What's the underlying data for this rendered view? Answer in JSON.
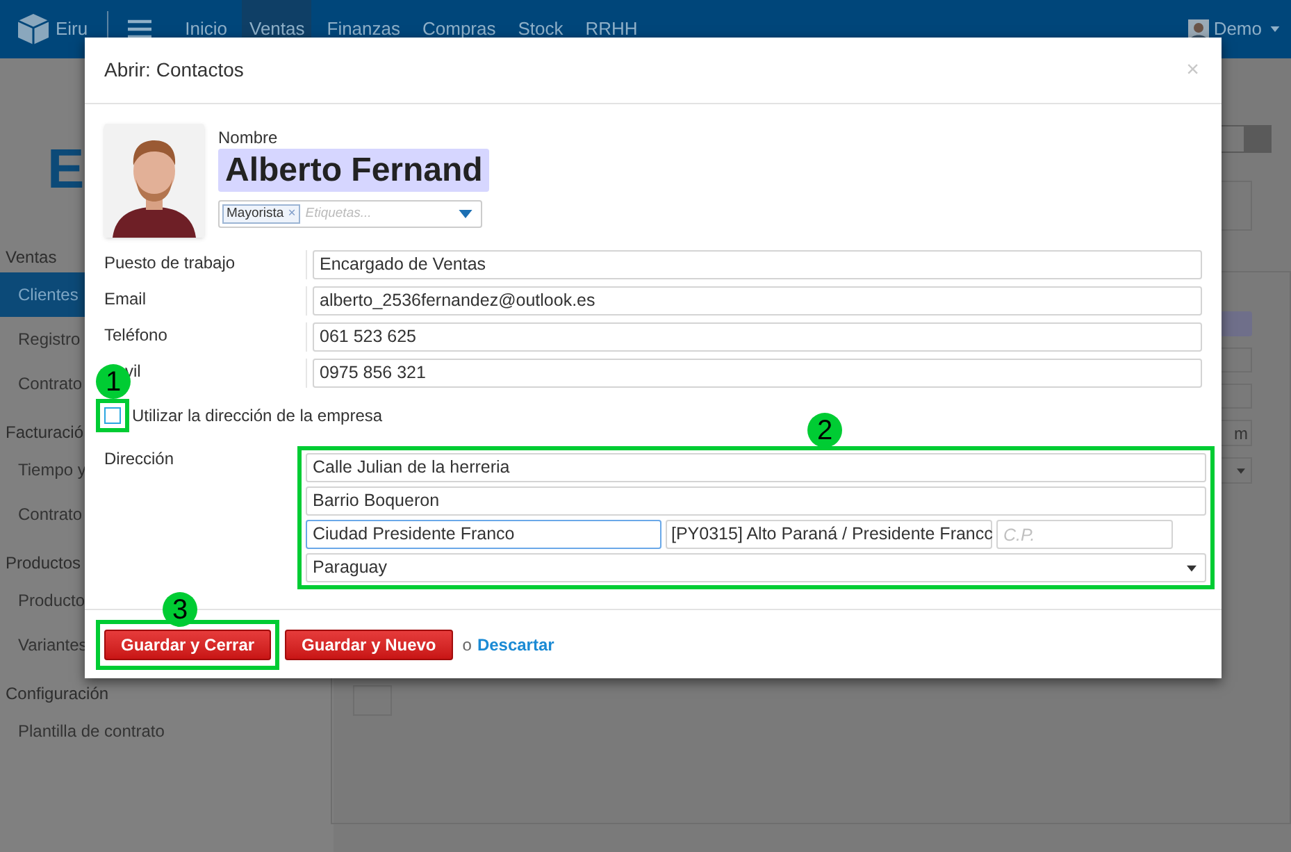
{
  "navbar": {
    "brand": "Eiru",
    "menu": [
      {
        "label": "Inicio",
        "selected": false
      },
      {
        "label": "Ventas",
        "selected": true
      },
      {
        "label": "Finanzas",
        "selected": false
      },
      {
        "label": "Compras",
        "selected": false
      },
      {
        "label": "Stock",
        "selected": false
      },
      {
        "label": "RRHH",
        "selected": false
      }
    ],
    "user": "Demo"
  },
  "page_title": "E",
  "sidebar": {
    "sections": [
      {
        "title": "Ventas",
        "items": [
          {
            "label": "Clientes",
            "selected": true
          },
          {
            "label": "Registro",
            "selected": false
          },
          {
            "label": "Contrato",
            "selected": false
          }
        ]
      },
      {
        "title": "Facturació",
        "items": [
          {
            "label": "Tiempo y",
            "selected": false
          },
          {
            "label": "Contrato",
            "selected": false
          }
        ]
      },
      {
        "title": "Productos",
        "items": [
          {
            "label": "Producto",
            "selected": false
          },
          {
            "label": "Variantes",
            "selected": false
          }
        ]
      },
      {
        "title": "Configuración",
        "items": [
          {
            "label": "Plantilla de contrato",
            "selected": false
          }
        ]
      }
    ]
  },
  "background_form": {
    "field_fragment": "m"
  },
  "dialog": {
    "title": "Abrir: Contactos",
    "close": "×",
    "name_label": "Nombre",
    "name_value": "Alberto Fernand",
    "tags": [
      {
        "label": "Mayorista",
        "remove": "×"
      }
    ],
    "tags_placeholder": "Etiquetas...",
    "fields": [
      {
        "label": "Puesto de trabajo",
        "value": "Encargado de Ventas"
      },
      {
        "label": "Email",
        "value": "alberto_2536fernandez@outlook.es"
      },
      {
        "label": "Teléfono",
        "value": "061 523 625"
      },
      {
        "label": "vil",
        "value": "0975 856 321"
      }
    ],
    "company_address": {
      "label": "Utilizar la dirección de la empresa",
      "checked": false
    },
    "address": {
      "label": "Dirección",
      "street": "Calle Julian de la herreria",
      "street2": "Barrio Boqueron",
      "city": "Ciudad Presidente Franco",
      "state": "[PY0315] Alto Paraná / Presidente Francc",
      "zip_placeholder": "C.P.",
      "country": "Paraguay"
    },
    "buttons": [
      {
        "label": "Guardar y Cerrar"
      },
      {
        "label": "Guardar y Nuevo"
      }
    ],
    "separator": "o",
    "discard": "Descartar"
  },
  "annotations": [
    {
      "label": "1"
    },
    {
      "label": "2"
    },
    {
      "label": "3"
    }
  ]
}
